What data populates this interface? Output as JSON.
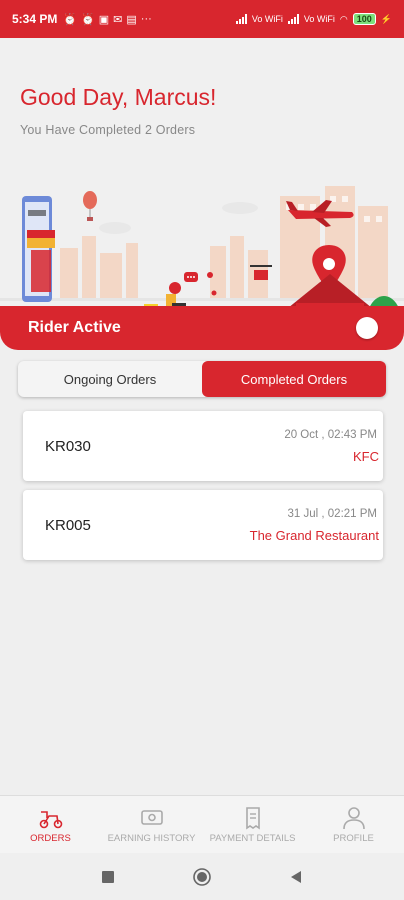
{
  "status_bar": {
    "time": "5:34 PM",
    "network_label_1": "Vo WiFi",
    "network_label_2": "Vo WiFi",
    "battery": "100",
    "icons": [
      "alarm-off-icon",
      "alarm-icon",
      "flipboard-icon",
      "gmail-icon",
      "news-icon",
      "more-icon",
      "signal-icon",
      "wifi-icon",
      "battery-icon",
      "charging-icon"
    ]
  },
  "header": {
    "greeting": "Good Day, Marcus!",
    "completed_text": "You Have Completed  2 Orders"
  },
  "rider": {
    "label": "Rider Active",
    "active": true
  },
  "tabs": [
    {
      "label": "Ongoing Orders",
      "active": false
    },
    {
      "label": "Completed Orders",
      "active": true
    }
  ],
  "orders": [
    {
      "id": "KR030",
      "date": "20 Oct , 02:43 PM",
      "shop": "KFC"
    },
    {
      "id": "KR005",
      "date": "31 Jul , 02:21 PM",
      "shop": "The Grand Restaurant"
    }
  ],
  "nav": [
    {
      "label": "ORDERS",
      "icon": "scooter-icon",
      "active": true
    },
    {
      "label": "EARNING HISTORY",
      "icon": "cash-icon",
      "active": false
    },
    {
      "label": "PAYMENT DETAILS",
      "icon": "receipt-icon",
      "active": false
    },
    {
      "label": "PROFILE",
      "icon": "person-icon",
      "active": false
    }
  ],
  "colors": {
    "brand": "#d8262e",
    "background": "#efefef"
  }
}
